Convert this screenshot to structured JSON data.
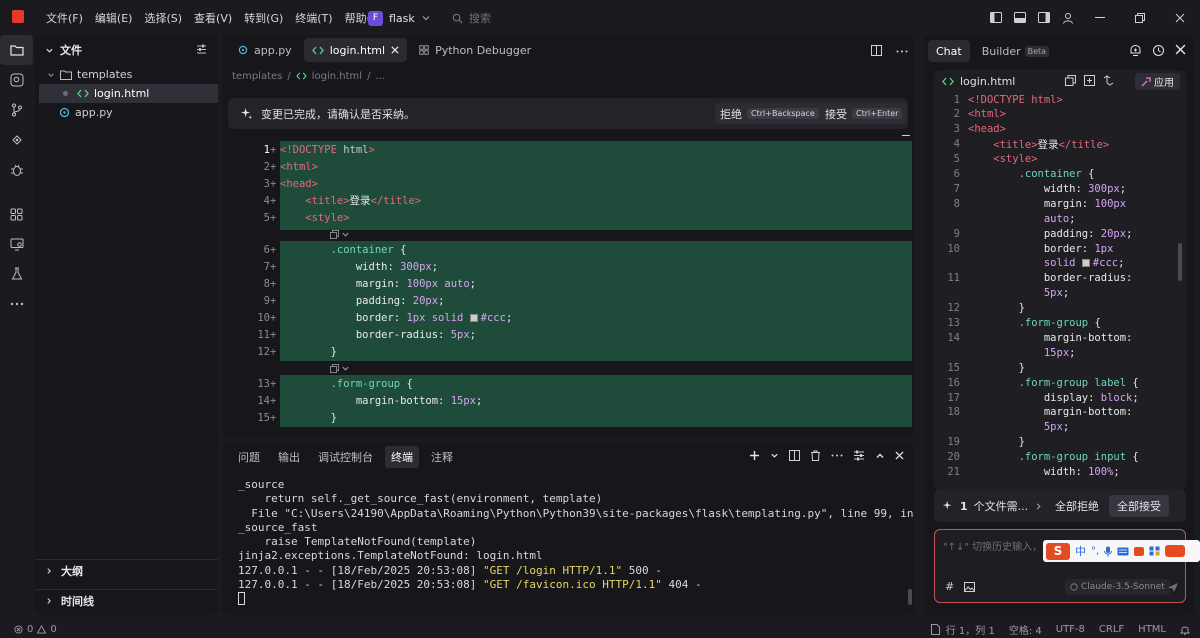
{
  "menu": [
    "文件(F)",
    "编辑(E)",
    "选择(S)",
    "查看(V)",
    "转到(G)",
    "终端(T)",
    "帮助(H)"
  ],
  "project": {
    "letter": "F",
    "name": "flask"
  },
  "search": {
    "placeholder": "搜索"
  },
  "explorer": {
    "title": "文件",
    "folder": "templates",
    "file_selected": "login.html",
    "file_other": "app.py",
    "outline": "大纲",
    "timeline": "时间线"
  },
  "editor": {
    "tabs": [
      "app.py",
      "login.html",
      "Python Debugger"
    ],
    "breadcrumb": [
      "templates",
      "login.html",
      "..."
    ],
    "diffbar": {
      "message": "变更已完成，请确认是否采纳。",
      "reject": "拒绝",
      "reject_key": "Ctrl+Backspace",
      "accept": "接受",
      "accept_key": "Ctrl+Enter"
    },
    "lines": [
      {
        "n": "1",
        "parts": [
          [
            "tg",
            "<!DOCTYPE "
          ],
          [
            "at",
            "html"
          ],
          [
            "tg",
            ">"
          ]
        ]
      },
      {
        "n": "2",
        "parts": [
          [
            "tg",
            "<html>"
          ]
        ]
      },
      {
        "n": "3",
        "parts": [
          [
            "tg",
            "<head>"
          ]
        ]
      },
      {
        "n": "4",
        "parts": [
          [
            "tg",
            "    <title>"
          ],
          [
            "str",
            "登录"
          ],
          [
            "tg",
            "</title>"
          ]
        ]
      },
      {
        "n": "5",
        "parts": [
          [
            "tg",
            "    <style>"
          ]
        ]
      },
      {
        "n": "6",
        "parts": [
          [
            "sel",
            "        .container "
          ],
          [
            "br",
            "{"
          ]
        ]
      },
      {
        "n": "7",
        "parts": [
          [
            "pr",
            "            width: "
          ],
          [
            "vl",
            "300px"
          ],
          [
            "pr",
            ";"
          ]
        ]
      },
      {
        "n": "8",
        "parts": [
          [
            "pr",
            "            margin: "
          ],
          [
            "vl",
            "100px auto"
          ],
          [
            "pr",
            ";"
          ]
        ]
      },
      {
        "n": "9",
        "parts": [
          [
            "pr",
            "            padding: "
          ],
          [
            "vl",
            "20px"
          ],
          [
            "pr",
            ";"
          ]
        ]
      },
      {
        "n": "10",
        "parts": [
          [
            "pr",
            "            border: "
          ],
          [
            "vl",
            "1px solid "
          ],
          [
            "sw",
            ""
          ],
          [
            "vl",
            "#ccc"
          ],
          [
            "pr",
            ";"
          ]
        ]
      },
      {
        "n": "11",
        "parts": [
          [
            "pr",
            "            border-radius: "
          ],
          [
            "vl",
            "5px"
          ],
          [
            "pr",
            ";"
          ]
        ]
      },
      {
        "n": "12",
        "parts": [
          [
            "br",
            "        }"
          ]
        ]
      },
      {
        "n": "13",
        "parts": [
          [
            "sel",
            "        .form-group "
          ],
          [
            "br",
            "{"
          ]
        ]
      },
      {
        "n": "14",
        "parts": [
          [
            "pr",
            "            margin-bottom: "
          ],
          [
            "vl",
            "15px"
          ],
          [
            "pr",
            ";"
          ]
        ]
      },
      {
        "n": "15",
        "parts": [
          [
            "br",
            "        }"
          ]
        ]
      }
    ]
  },
  "terminal": {
    "tabs": [
      "问题",
      "输出",
      "调试控制台",
      "终端",
      "注释"
    ],
    "lines": [
      [
        [
          "",
          "_source"
        ]
      ],
      [
        [
          "",
          "    return self._get_source_fast(environment, template)"
        ]
      ],
      [
        [
          "",
          "  File \"C:\\Users\\24190\\AppData\\Roaming\\Python\\Python39\\site-packages\\flask\\templating.py\", line 99, in _get"
        ]
      ],
      [
        [
          "",
          "_source_fast"
        ]
      ],
      [
        [
          "",
          "    raise TemplateNotFound(template)"
        ]
      ],
      [
        [
          "",
          "jinja2.exceptions.TemplateNotFound: login.html"
        ]
      ],
      [
        [
          "",
          "127.0.0.1 - - [18/Feb/2025 20:53:08] "
        ],
        [
          "ty",
          "\"GET /login HTTP/1.1\""
        ],
        [
          "",
          " 500 -"
        ]
      ],
      [
        [
          "",
          "127.0.0.1 - - [18/Feb/2025 20:53:08] "
        ],
        [
          "ty",
          "\"GET /favicon.ico HTTP/1.1\""
        ],
        [
          "",
          " 404 -"
        ]
      ]
    ]
  },
  "chat": {
    "tabs": [
      "Chat",
      "Builder"
    ],
    "beta": "Beta",
    "file": "login.html",
    "apply": "应用",
    "code": [
      {
        "n": "1",
        "parts": [
          [
            "tg",
            "<!DOCTYPE html>"
          ]
        ]
      },
      {
        "n": "2",
        "parts": [
          [
            "tg",
            "<html>"
          ]
        ]
      },
      {
        "n": "3",
        "parts": [
          [
            "tg",
            "<head>"
          ]
        ]
      },
      {
        "n": "4",
        "parts": [
          [
            "tg",
            "    <title>"
          ],
          [
            "str",
            "登录"
          ],
          [
            "tg",
            "</title>"
          ]
        ]
      },
      {
        "n": "5",
        "parts": [
          [
            "tg",
            "    <style>"
          ]
        ]
      },
      {
        "n": "6",
        "parts": [
          [
            "sel",
            "        .container "
          ],
          [
            "br",
            "{"
          ]
        ]
      },
      {
        "n": "7",
        "parts": [
          [
            "pr",
            "            width: "
          ],
          [
            "vl",
            "300px"
          ],
          [
            "pr",
            ";"
          ]
        ]
      },
      {
        "n": "8",
        "parts": [
          [
            "pr",
            "            margin: "
          ],
          [
            "vl",
            "100px"
          ]
        ]
      },
      {
        "n": "",
        "parts": [
          [
            "vl",
            "            auto"
          ],
          [
            "pr",
            ";"
          ]
        ]
      },
      {
        "n": "9",
        "parts": [
          [
            "pr",
            "            padding: "
          ],
          [
            "vl",
            "20px"
          ],
          [
            "pr",
            ";"
          ]
        ]
      },
      {
        "n": "10",
        "parts": [
          [
            "pr",
            "            border: "
          ],
          [
            "vl",
            "1px"
          ]
        ]
      },
      {
        "n": "",
        "parts": [
          [
            "vl",
            "            solid "
          ],
          [
            "sw",
            ""
          ],
          [
            "vl",
            "#ccc"
          ],
          [
            "pr",
            ";"
          ]
        ]
      },
      {
        "n": "11",
        "parts": [
          [
            "pr",
            "            border-radius:"
          ]
        ]
      },
      {
        "n": "",
        "parts": [
          [
            "vl",
            "            5px"
          ],
          [
            "pr",
            ";"
          ]
        ]
      },
      {
        "n": "12",
        "parts": [
          [
            "br",
            "        }"
          ]
        ]
      },
      {
        "n": "13",
        "parts": [
          [
            "sel",
            "        .form-group "
          ],
          [
            "br",
            "{"
          ]
        ]
      },
      {
        "n": "14",
        "parts": [
          [
            "pr",
            "            margin-bottom:"
          ]
        ]
      },
      {
        "n": "",
        "parts": [
          [
            "vl",
            "            15px"
          ],
          [
            "pr",
            ";"
          ]
        ]
      },
      {
        "n": "15",
        "parts": [
          [
            "br",
            "        }"
          ]
        ]
      },
      {
        "n": "16",
        "parts": [
          [
            "sel",
            "        .form-group label "
          ],
          [
            "br",
            "{"
          ]
        ]
      },
      {
        "n": "17",
        "parts": [
          [
            "pr",
            "            display: "
          ],
          [
            "vl",
            "block"
          ],
          [
            "pr",
            ";"
          ]
        ]
      },
      {
        "n": "18",
        "parts": [
          [
            "pr",
            "            margin-bottom:"
          ]
        ]
      },
      {
        "n": "",
        "parts": [
          [
            "vl",
            "            5px"
          ],
          [
            "pr",
            ";"
          ]
        ]
      },
      {
        "n": "19",
        "parts": [
          [
            "br",
            "        }"
          ]
        ]
      },
      {
        "n": "20",
        "parts": [
          [
            "sel",
            "        .form-group input "
          ],
          [
            "br",
            "{"
          ]
        ]
      },
      {
        "n": "21",
        "parts": [
          [
            "pr",
            "            width: "
          ],
          [
            "vl",
            "100%"
          ],
          [
            "pr",
            ";"
          ]
        ]
      }
    ],
    "changes": {
      "count": "1",
      "text": "个文件需...",
      "reject_all": "全部拒绝",
      "accept_all": "全部接受"
    },
    "input_placeholder": "\"↑↓\" 切换历史输入，\"S",
    "model": "Claude-3.5-Sonnet",
    "ime_char": "中"
  },
  "status": {
    "errors": "0",
    "warnings": "0",
    "position": "行 1，列 1",
    "spaces": "空格: 4",
    "encoding": "UTF-8",
    "eol": "CRLF",
    "language": "HTML"
  }
}
